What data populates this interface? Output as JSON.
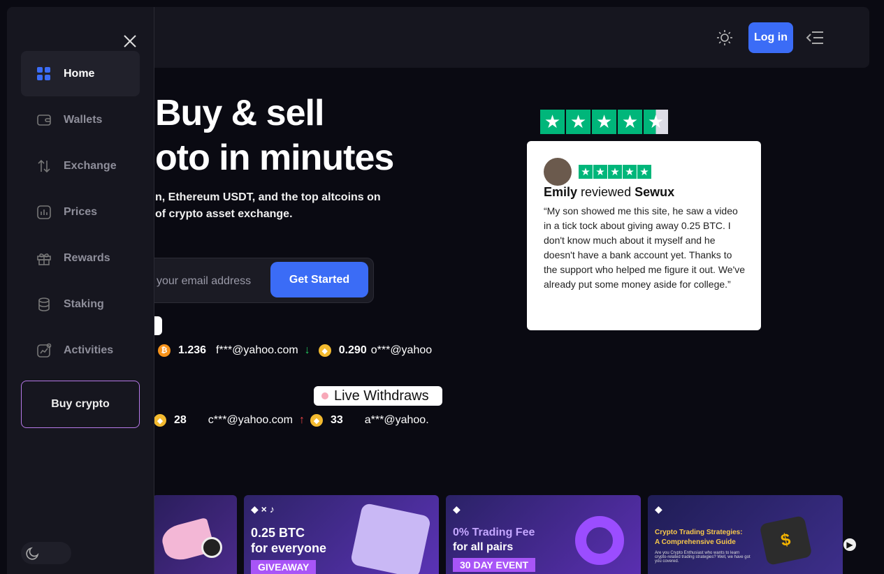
{
  "header": {
    "login_label": "Log in"
  },
  "hero": {
    "title": "Buy & sell\noto in minutes",
    "subtitle": "n, Ethereum USDT, and the top altcoins on\nof crypto asset exchange.",
    "email_placeholder": "your email address",
    "cta_label": "Get Started"
  },
  "ticker_row1": [
    {
      "coin": "BTC",
      "amount": "1.236",
      "email": "f***@yahoo.com",
      "direction": "down"
    },
    {
      "coin": "BNB",
      "amount": "0.290",
      "email": "o***@yahoo"
    }
  ],
  "withdraws": {
    "label": "Live Withdraws",
    "items": [
      {
        "coin": "BNB",
        "amount": "28",
        "email": "c***@yahoo.com",
        "direction": "up"
      },
      {
        "coin": "BNB",
        "amount": "33",
        "email": "a***@yahoo."
      }
    ]
  },
  "review": {
    "name": "Emily",
    "verb": "reviewed",
    "company": "Sewux",
    "text": "“My son showed me this site, he saw a video in a tick tock about giving away 0.25 BTC. I don't know much about it myself and he doesn't have a bank account yet. Thanks to the support who helped me figure it out. We've already put some money aside for college.”",
    "rating": 4.5
  },
  "banners": [
    {
      "title": "",
      "sub": "",
      "tag": ""
    },
    {
      "title": "0.25 BTC",
      "sub": "for everyone",
      "tag": "GIVEAWAY"
    },
    {
      "title": "0% Trading Fee",
      "sub": "for all pairs",
      "tag": "30 DAY EVENT"
    },
    {
      "title": "Crypto Trading Strategies:",
      "sub": "A Comprehensive Guide",
      "tag": "Are you Crypto Enthusiast who wants to learn crypto-related trading strategies? Well, we have got you covered."
    }
  ],
  "sidebar": {
    "items": [
      {
        "label": "Home",
        "icon": "grid-icon"
      },
      {
        "label": "Wallets",
        "icon": "wallet-icon"
      },
      {
        "label": "Exchange",
        "icon": "exchange-arrows-icon"
      },
      {
        "label": "Prices",
        "icon": "chart-bars-icon"
      },
      {
        "label": "Rewards",
        "icon": "gift-icon"
      },
      {
        "label": "Staking",
        "icon": "coin-stack-icon"
      },
      {
        "label": "Activities",
        "icon": "activity-chart-icon"
      }
    ],
    "buy_label": "Buy crypto"
  },
  "colors": {
    "accent": "#3b6cf6",
    "trustpilot": "#00b67a",
    "buy_border": "#b679e8"
  }
}
